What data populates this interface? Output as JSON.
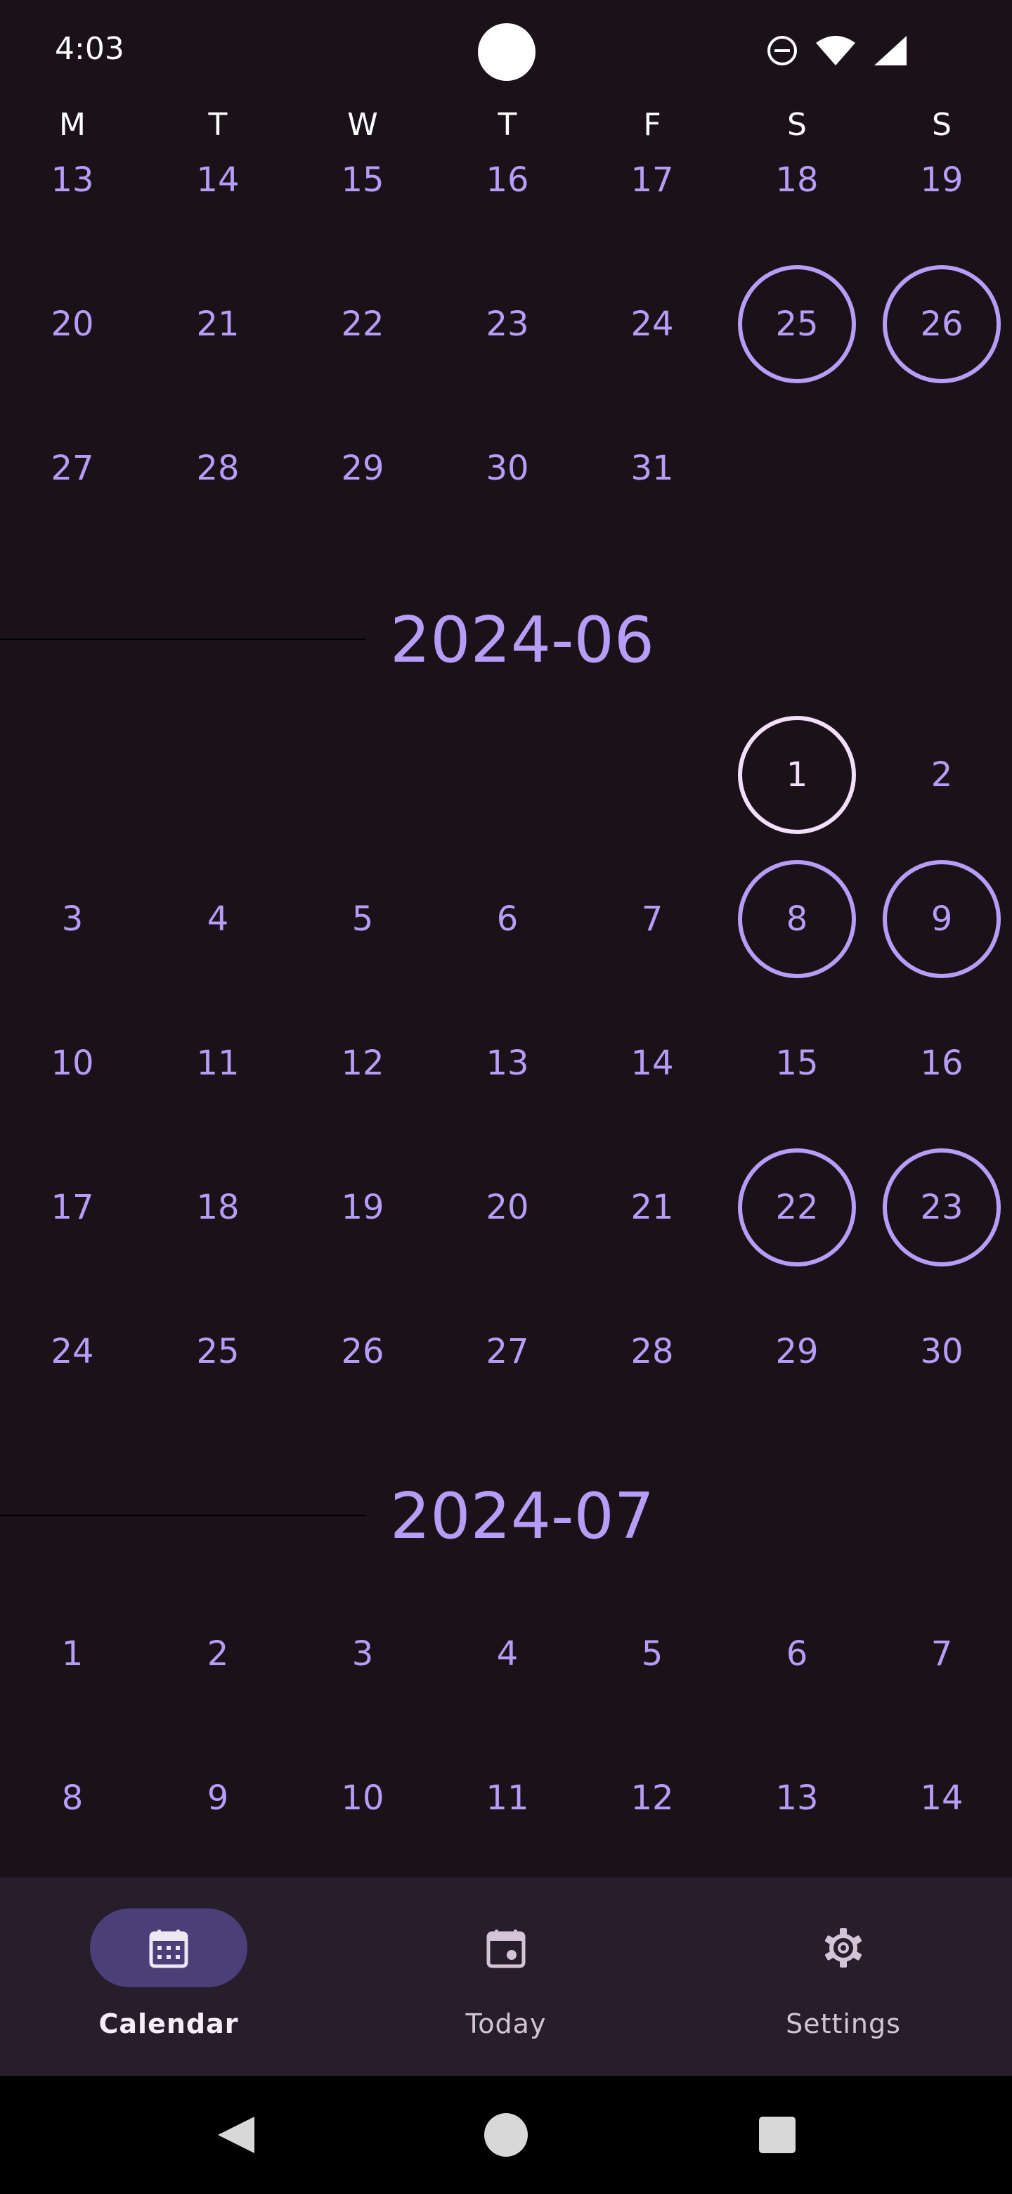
{
  "status_bar": {
    "time": "4:03",
    "icons": [
      "do-not-disturb-icon",
      "wifi-icon",
      "cellular-signal-icon"
    ]
  },
  "weekday_headers": [
    "M",
    "T",
    "W",
    "T",
    "F",
    "S",
    "S"
  ],
  "months": [
    {
      "label": "",
      "rows": [
        [
          "13",
          "14",
          "15",
          "16",
          "17",
          "18",
          "19"
        ],
        [
          "20",
          "21",
          "22",
          "23",
          "24",
          "25",
          "26"
        ],
        [
          "27",
          "28",
          "29",
          "30",
          "31",
          "",
          ""
        ]
      ],
      "weekend_marked_rows": [
        1
      ]
    },
    {
      "label": "2024-06",
      "rows": [
        [
          "",
          "",
          "",
          "",
          "",
          "1",
          "2"
        ],
        [
          "3",
          "4",
          "5",
          "6",
          "7",
          "8",
          "9"
        ],
        [
          "10",
          "11",
          "12",
          "13",
          "14",
          "15",
          "16"
        ],
        [
          "17",
          "18",
          "19",
          "20",
          "21",
          "22",
          "23"
        ],
        [
          "24",
          "25",
          "26",
          "27",
          "28",
          "29",
          "30"
        ]
      ],
      "today": "1",
      "weekend_marked_rows": [
        1,
        3
      ]
    },
    {
      "label": "2024-07",
      "rows": [
        [
          "1",
          "2",
          "3",
          "4",
          "5",
          "6",
          "7"
        ],
        [
          "8",
          "9",
          "10",
          "11",
          "12",
          "13",
          "14"
        ]
      ],
      "weekend_marked_rows": []
    }
  ],
  "bottom_nav": {
    "items": [
      {
        "label": "Calendar",
        "icon": "calendar-month-icon",
        "active": true
      },
      {
        "label": "Today",
        "icon": "calendar-today-icon",
        "active": false
      },
      {
        "label": "Settings",
        "icon": "gear-icon",
        "active": false
      }
    ]
  },
  "system_nav": [
    "back-icon",
    "home-icon",
    "recents-icon"
  ],
  "colors": {
    "background": "#1b1118",
    "accent": "#b69df8",
    "today_ring": "#f3dffc",
    "nav_background": "#261e2b",
    "nav_active_pill": "#4a3f78"
  }
}
